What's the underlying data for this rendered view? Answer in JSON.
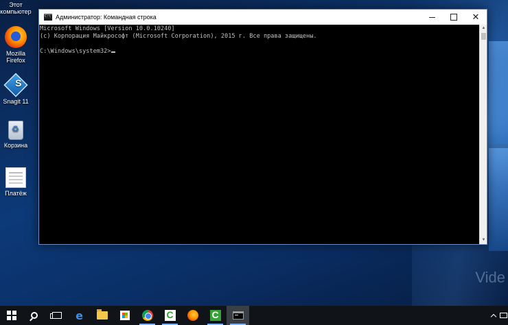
{
  "desktop": {
    "icons": [
      {
        "label": "Этот компьютер",
        "icon": "this-pc-icon"
      },
      {
        "label": "Mozilla Firefox",
        "icon": "firefox-icon"
      },
      {
        "label": "Snagit 11",
        "icon": "snagit-icon"
      },
      {
        "label": "Корзина",
        "icon": "recycle-bin-icon"
      },
      {
        "label": "Платёж",
        "icon": "document-icon"
      }
    ],
    "watermark": "Vide"
  },
  "window": {
    "title": "Администратор: Командная строка",
    "icon": "cmd-icon",
    "controls": {
      "minimize": "minimize-icon",
      "maximize": "maximize-icon",
      "close": "✕"
    }
  },
  "console": {
    "lines": [
      "Microsoft Windows [Version 10.0.10240]",
      "(c) Корпорация Майкрософт (Microsoft Corporation), 2015 г. Все права защищены.",
      "",
      "C:\\Windows\\system32>"
    ],
    "scroll_up": "▲",
    "scroll_down": "▼"
  },
  "taskbar": {
    "items": [
      {
        "icon": "windows-start-icon",
        "state": "idle"
      },
      {
        "icon": "search-icon",
        "state": "idle"
      },
      {
        "icon": "task-view-icon",
        "state": "idle"
      },
      {
        "icon": "edge-icon",
        "state": "idle"
      },
      {
        "icon": "file-explorer-icon",
        "state": "idle"
      },
      {
        "icon": "store-icon",
        "state": "idle"
      },
      {
        "icon": "chrome-icon",
        "state": "running"
      },
      {
        "icon": "camtasia-recorder-icon",
        "state": "running"
      },
      {
        "icon": "firefox-icon",
        "state": "idle"
      },
      {
        "icon": "camtasia-studio-icon",
        "state": "running"
      },
      {
        "icon": "cmd-icon",
        "state": "active"
      }
    ],
    "tray": [
      "show-hidden-icons-icon",
      "screen-icon"
    ]
  },
  "colors": {
    "console_bg": "#000000",
    "console_text": "#c0c0c0",
    "taskbar_bg": "#101418",
    "wallpaper_accent": "#0c3a78"
  }
}
